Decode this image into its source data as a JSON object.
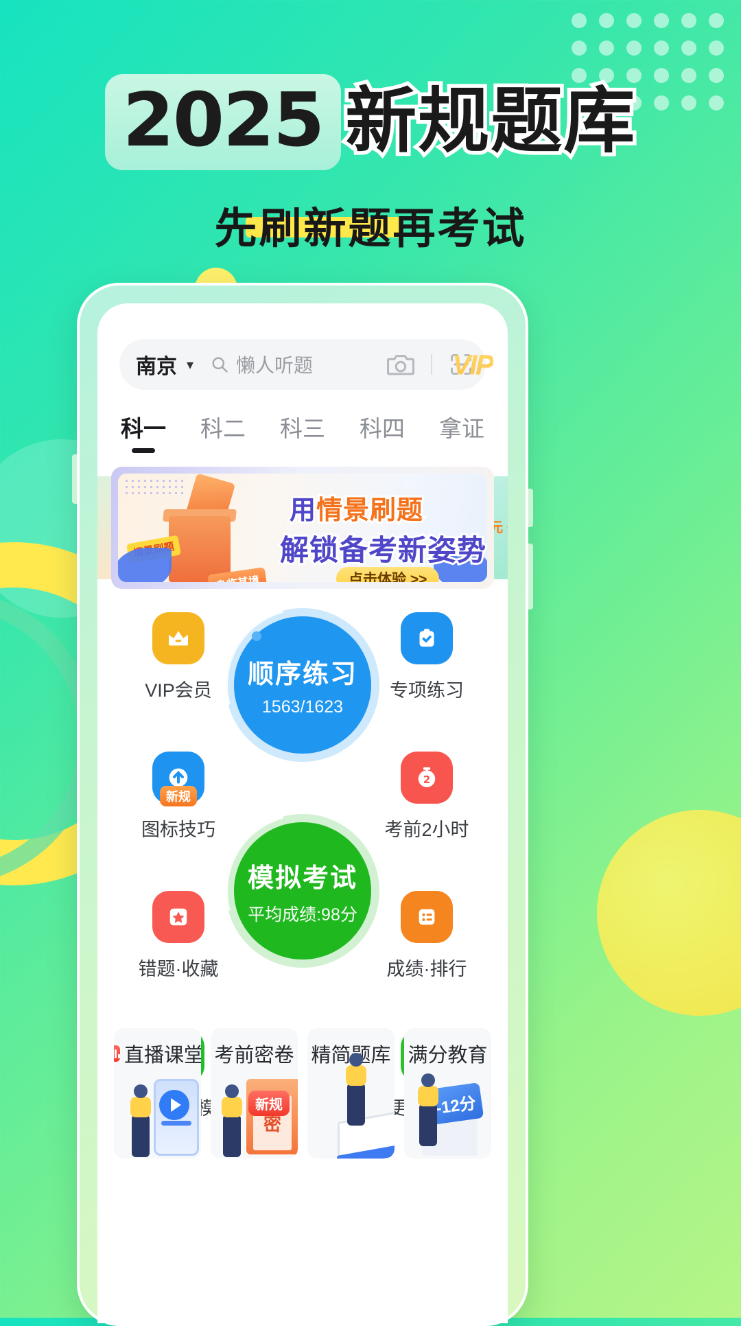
{
  "poster": {
    "year": "2025",
    "title": "新规题库",
    "subtitle": "先刷新题再考试"
  },
  "app": {
    "search": {
      "city": "南京",
      "chevron": "chevron-down-icon",
      "placeholder": "懒人听题",
      "search_icon": "search-icon",
      "camera_icon": "camera-icon",
      "scan_icon": "scan-icon"
    },
    "vip_label": "VIP",
    "tabs": [
      {
        "label": "科一",
        "active": true
      },
      {
        "label": "科二",
        "active": false
      },
      {
        "label": "科三",
        "active": false
      },
      {
        "label": "科四",
        "active": false
      },
      {
        "label": "拿证",
        "active": false
      }
    ],
    "banner": {
      "line1_a": "用",
      "line1_b": "情景刷题",
      "line2": "解锁备考新姿势",
      "cta": "点击体验 >>",
      "tag_yellow": "情景刷题",
      "tag_orange": "身临其境",
      "next_slide_text": "元\n开学"
    },
    "left_icons": [
      {
        "label": "VIP会员",
        "icon": "crown-icon",
        "color": "#f5b521"
      },
      {
        "label": "图标技巧",
        "icon": "up-arrow-icon",
        "color": "#1f93f0",
        "badge": "新规"
      },
      {
        "label": "错题·收藏",
        "icon": "star-icon",
        "color": "#f85a53"
      },
      {
        "label": "真实考场模式",
        "icon": "monitor-icon",
        "color": "#1fbf2b"
      }
    ],
    "right_icons": [
      {
        "label": "专项练习",
        "icon": "clipboard-check-icon",
        "color": "#1f93f0"
      },
      {
        "label": "考前2小时",
        "icon": "stopwatch-icon",
        "color": "#f8554f"
      },
      {
        "label": "成绩·排行",
        "icon": "list-icon",
        "color": "#f5851f"
      },
      {
        "label": "更多功能",
        "icon": "grid-icon",
        "color": "#2ebf2e"
      }
    ],
    "circles": [
      {
        "title": "顺序练习",
        "sub": "1563/1623",
        "color": "#1f96f0"
      },
      {
        "title": "模拟考试",
        "sub": "平均成绩:98分",
        "color": "#1fb81f"
      }
    ],
    "cards": [
      {
        "title": "直播课堂",
        "has_live_chip": true,
        "art": "phone-play-art"
      },
      {
        "title": "考前密卷",
        "art": "envelope-art",
        "badge": "新规",
        "seal": "密"
      },
      {
        "title": "精简题库",
        "art": "books-art"
      },
      {
        "title": "满分教育",
        "art": "score-art",
        "score": "-12分"
      }
    ]
  }
}
